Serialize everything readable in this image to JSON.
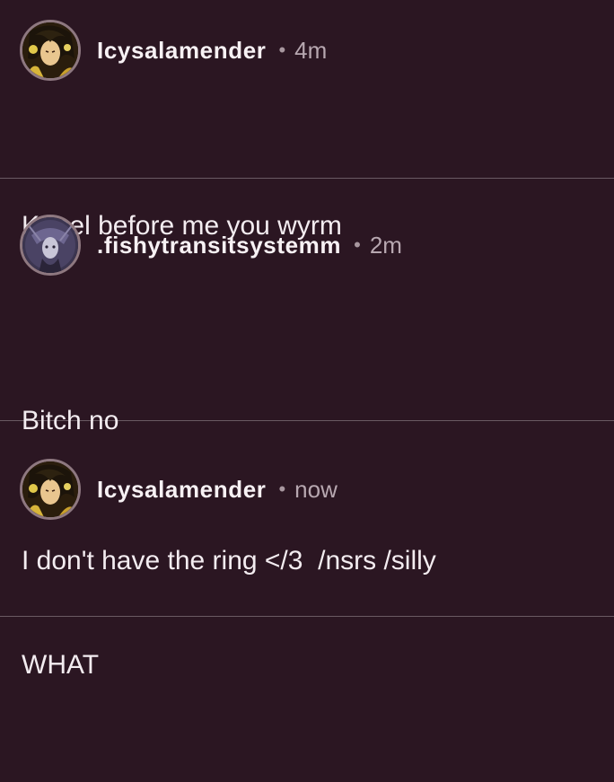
{
  "comments": [
    {
      "username": "Icysalamender",
      "time": "4m",
      "avatar_icon": "anime-character-avatar-icon",
      "lines": [
        "Kneel before me you wyrm"
      ]
    },
    {
      "username": ".fishytransitsystemm",
      "time": "2m",
      "avatar_icon": "dark-character-avatar-icon",
      "lines": [
        "Bitch no",
        "I don't have the ring </3  /nsrs /silly"
      ]
    },
    {
      "username": "Icysalamender",
      "time": "now",
      "avatar_icon": "anime-character-avatar-icon",
      "lines": [
        "WHAT"
      ]
    }
  ],
  "separator": "•",
  "colors": {
    "background": "#2b1622",
    "divider": "#6a5a63",
    "text": "#f3ecf0",
    "muted": "#b7a7b0"
  }
}
